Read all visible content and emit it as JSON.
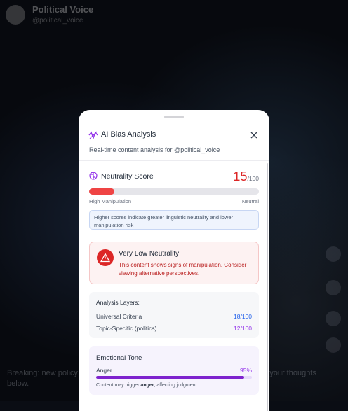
{
  "background": {
    "user_name": "Political Voice",
    "user_handle": "@political_voice",
    "caption": "Breaking: new policy announcement sparks debate across the nation. Share your thoughts below."
  },
  "panel": {
    "title": "AI Bias Analysis",
    "subtitle": "Real-time content analysis for @political_voice",
    "close_icon": "close-icon",
    "title_icon": "wave-pulse-icon"
  },
  "neutrality": {
    "label": "Neutrality Score",
    "icon": "brain-icon",
    "score": "15",
    "max": "/100",
    "fraction": 0.15,
    "scale_left": "High Manipulation",
    "scale_right": "Neutral",
    "info": "Higher scores indicate greater linguistic neutrality and lower manipulation risk"
  },
  "alert": {
    "icon": "warning-triangle-icon",
    "title": "Very Low Neutrality",
    "text": "This content shows signs of manipulation. Consider viewing alternative perspectives."
  },
  "layers": {
    "title": "Analysis Layers:",
    "items": [
      {
        "name": "Universal Criteria",
        "value": "18/100",
        "color": "#2563eb"
      },
      {
        "name": "Topic-Specific (politics)",
        "value": "12/100",
        "color": "#9333ea"
      }
    ]
  },
  "tone": {
    "title": "Emotional Tone",
    "emotion": "Anger",
    "percent": "95%",
    "fraction": 0.95,
    "note_prefix": "Content may trigger ",
    "note_bold": "anger",
    "note_suffix": ", affecting judgment"
  },
  "colors": {
    "accent": "#9333ea",
    "danger": "#dc2626",
    "info_bg": "#eff4fd"
  }
}
